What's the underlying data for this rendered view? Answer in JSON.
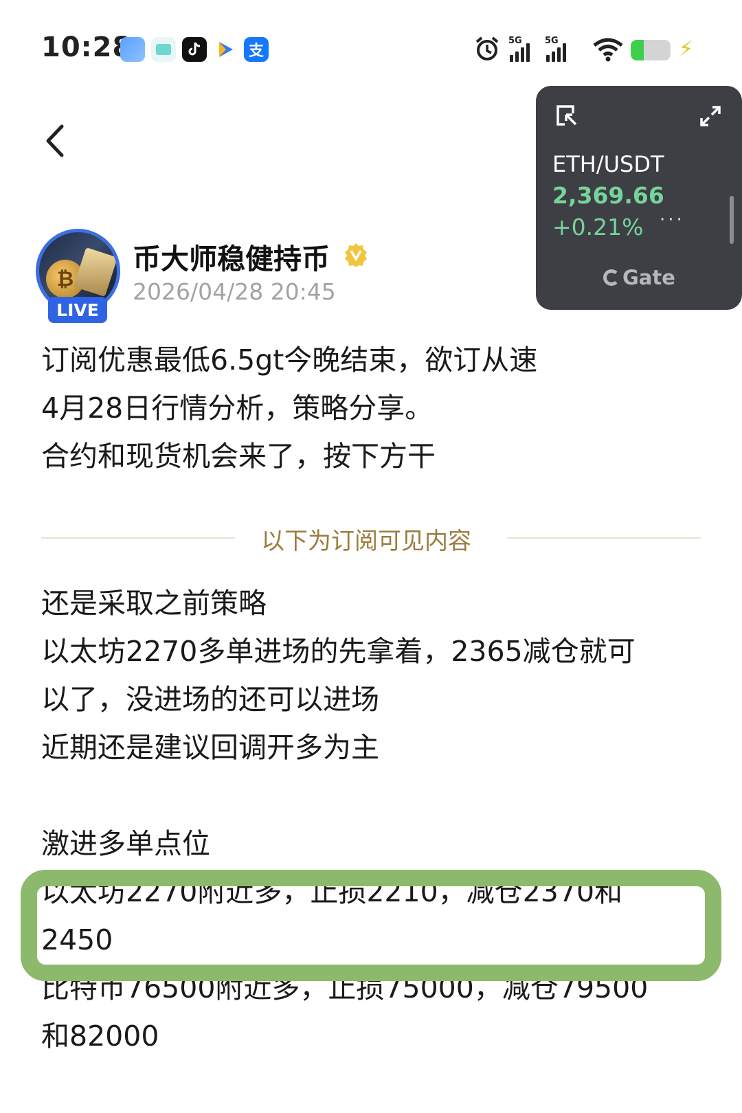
{
  "status_bar": {
    "time": "10:28",
    "apps": [
      {
        "icon": "blue-app-icon",
        "color": "#4a8df8"
      },
      {
        "icon": "teal-app-icon",
        "color": "#6fd6d0"
      },
      {
        "icon": "tiktok-icon",
        "color": "#111111"
      },
      {
        "icon": "play-arrow-app-icon",
        "color": "#2f7bf5"
      },
      {
        "icon": "alipay-icon",
        "color": "#1677ff",
        "glyph": "支"
      }
    ],
    "network_1": "5G",
    "network_2": "5G"
  },
  "ticker": {
    "pair": "ETH/USDT",
    "price": "2,369.66",
    "change": "+0.21%",
    "brand": "Gate",
    "accent": "#76d39a"
  },
  "author": {
    "name": "币大师稳健持币",
    "post_time": "2026/04/28 20:45",
    "live_badge": "LIVE",
    "avatar_coin": "₿"
  },
  "post": {
    "intro_lines": [
      "订阅优惠最低6.5gt今晚结束，欲订从速",
      "4月28日行情分析，策略分享。",
      "合约和现货机会来了，按下方干"
    ],
    "subscribe_divider": "以下为订阅可见内容",
    "strategy_lines": [
      "还是采取之前策略",
      "以太坊2270多单进场的先拿着，2365减仓就可",
      "以了，没进场的还可以进场",
      "近期还是建议回调开多为主"
    ],
    "points_title": "激进多单点位",
    "points_lines": [
      "以太坊2270附近多，止损2210，减仓2370和",
      "2450",
      "比特币76500附近多，止损75000，减仓79500",
      "和82000"
    ]
  },
  "highlight_color": "#8cb96b"
}
